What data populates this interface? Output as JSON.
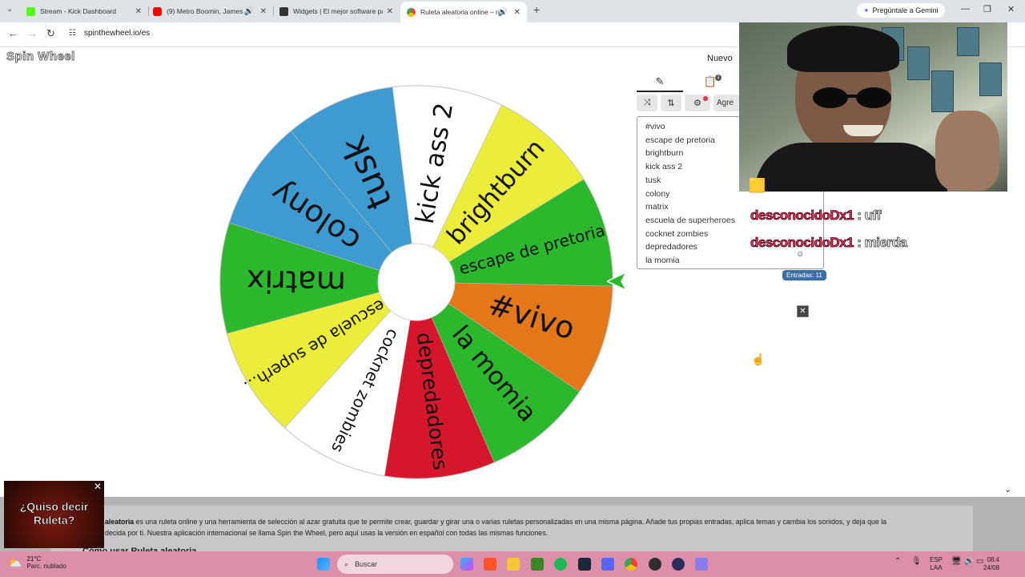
{
  "browser": {
    "tabs": [
      {
        "title": "Stream - Kick Dashboard",
        "active": false,
        "color": "#53fc18"
      },
      {
        "title": "(9) Metro Boomin, James Bl",
        "active": false,
        "color": "#ff0000"
      },
      {
        "title": "Widgets | El mejor software pa",
        "active": false,
        "color": "#333333"
      },
      {
        "title": "Ruleta aleatoria online – ru",
        "active": true,
        "color": "#4285f4"
      }
    ],
    "new_tab": "+",
    "url": "spinthewheel.io/es",
    "gemini": "Pregúntale a Gemini"
  },
  "site": {
    "logo": "Spin Wheel",
    "nuevo": "Nuevo"
  },
  "wheel": {
    "segments": [
      {
        "label": "kick ass 2",
        "color": "#ffffff"
      },
      {
        "label": "brightburn",
        "color": "#ecec3a"
      },
      {
        "label": "escape de pretoria",
        "color": "#2cb82c"
      },
      {
        "label": "#vivo",
        "color": "#e47717"
      },
      {
        "label": "la momia",
        "color": "#2cb82c"
      },
      {
        "label": "depredadores",
        "color": "#d5162b"
      },
      {
        "label": "cocknet zombies",
        "color": "#ffffff"
      },
      {
        "label": "escuela de superh...",
        "color": "#ecec3a"
      },
      {
        "label": "matrix",
        "color": "#2cb82c"
      },
      {
        "label": "colony",
        "color": "#3d9bd1"
      },
      {
        "label": "tusk",
        "color": "#3d9bd1"
      }
    ],
    "pointer_color": "#2cb82c"
  },
  "panel": {
    "tabs": [
      {
        "icon": "pencil-icon"
      },
      {
        "icon": "clipboard-icon",
        "badge": "1"
      }
    ],
    "tools": [
      "shuffle-icon",
      "sort-icon",
      "settings-icon"
    ],
    "add_label": "Agre",
    "entries": [
      "#vivo",
      "escape de pretoria",
      "brightburn",
      "kick ass 2",
      "tusk",
      "colony",
      "matrix",
      "escuela de superheroes",
      "cocknet zombies",
      "depredadores",
      "la momia"
    ],
    "count_label": "Entradas: 11"
  },
  "chat": [
    {
      "user": "desconocidoDx1",
      "message": " : uff"
    },
    {
      "user": "desconocidoDx1",
      "message": " : mierda"
    }
  ],
  "chat_partial": "🟨 ",
  "description": {
    "bold": "aleatoria",
    "text": " es una ruleta online y una herramienta de selección al azar gratuita que te permite crear, guardar y girar una o varias ruletas personalizadas en una misma página. Añade tus propias entradas, aplica temas y cambia los sonidos, y deja que la ",
    "text2": "decida por ti. Nuestra aplicación internacional se llama Spin the Wheel, pero aquí usas la versión en español con todas las mismas funciones."
  },
  "howto": "Cómo usar Ruleta aleatoria",
  "ad": {
    "line1": "¿Quiso decir",
    "line2": "Ruleta?"
  },
  "taskbar": {
    "temp": "21°C",
    "condition": "Parc. nublado",
    "search": "Buscar",
    "lang1": "ESP",
    "lang2": "LAA",
    "time": "08:4",
    "date": "24/08"
  }
}
